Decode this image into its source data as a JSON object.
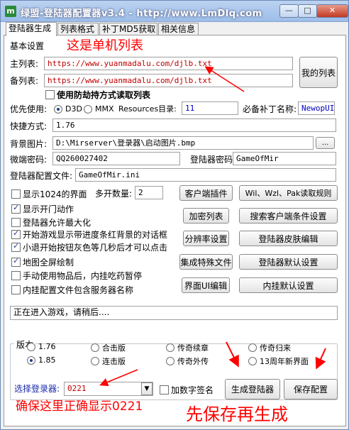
{
  "window": {
    "title": "绿盟-登陆器配置器v3.4 - http://www.LmDlq.com",
    "icon": "app-icon"
  },
  "tabs": [
    {
      "label": "登陆器生成",
      "active": true
    },
    {
      "label": "列表格式"
    },
    {
      "label": "补丁MD5获取"
    },
    {
      "label": "相关信息"
    }
  ],
  "basic": {
    "section_label": "基本设置",
    "main_list_label": "主列表:",
    "main_list_value": "https://www.yuanmadalu.com/djlb.txt",
    "backup_list_label": "备列表:",
    "backup_list_value": "https://www.yuanmadalu.com/djlb.txt",
    "my_list_button": "我的列表",
    "anti_hijack_label": "使用防劫持方式读取列表",
    "priority_label": "优先使用:",
    "d3d_label": "D3D",
    "mmx_label": "MMX",
    "resources_label": "Resources目录:",
    "resources_value": "11",
    "required_patch_label": "必备补丁名称:",
    "required_patch_value": "NewopUI",
    "shortcut_label": "快捷方式:",
    "shortcut_value": "1.76",
    "bg_image_label": "背景图片:",
    "bg_image_value": "D:\\Mirserver\\登录器\\启动图片.bmp",
    "browse_button": "...",
    "micro_pwd_label": "微端密码:",
    "micro_pwd_value": "QQ260027402",
    "login_pwd_label": "登陆器密码:",
    "login_pwd_value": "GameOfMir",
    "config_file_label": "登陆器配置文件:",
    "config_file_value": "GameOfMir.ini"
  },
  "options": [
    {
      "label": "显示1024的界面",
      "checked": false
    },
    {
      "label": "显示开门动作",
      "checked": true
    },
    {
      "label": "登陆器允许最大化",
      "checked": false
    },
    {
      "label": "开始游戏显示带进度条红背景的对话框",
      "checked": true
    },
    {
      "label": "小退开始按钮灰色等几秒后才可以点击",
      "checked": true
    },
    {
      "label": "地图全屏绘制",
      "checked": true
    },
    {
      "label": "手动使用物品后，内挂吃药暂停",
      "checked": false
    },
    {
      "label": "内挂配置文件包含服务器名称",
      "checked": false
    }
  ],
  "multi_open": {
    "label": "多开数量:",
    "value": "2"
  },
  "buttons_mid": [
    "客户端插件",
    "加密列表",
    "分辨率设置",
    "集成特殊文件",
    "界面UI编辑"
  ],
  "buttons_right": [
    "Wil、Wzl、Pak读取规则",
    "搜索客户端条件设置",
    "登陆器皮肤编辑",
    "登陆器默认设置",
    "内挂默认设置"
  ],
  "status_text": "正在进入游戏，请稍后....",
  "version": {
    "title": "版本",
    "items": [
      {
        "label": "1.76",
        "checked": false
      },
      {
        "label": "合击版",
        "checked": false
      },
      {
        "label": "传奇续章",
        "checked": false
      },
      {
        "label": "传奇归来",
        "checked": false
      },
      {
        "label": "1.85",
        "checked": true
      },
      {
        "label": "连击版",
        "checked": false
      },
      {
        "label": "传奇外传",
        "checked": false
      },
      {
        "label": "13周年新界面",
        "checked": false
      }
    ]
  },
  "bottom": {
    "select_label": "选择登录器:",
    "select_value": "0221",
    "sign_label": "加数字签名",
    "generate_button": "生成登陆器",
    "save_button": "保存配置"
  },
  "annotations": {
    "top": "这是单机列表",
    "bottom_left": "确保这里正确显示0221",
    "bottom_right": "先保存再生成",
    "color": "#ff0000"
  },
  "colors": {
    "title_bar": "#9dbde9",
    "accent_blue": "#0000c0",
    "url_red": "#c00000"
  }
}
